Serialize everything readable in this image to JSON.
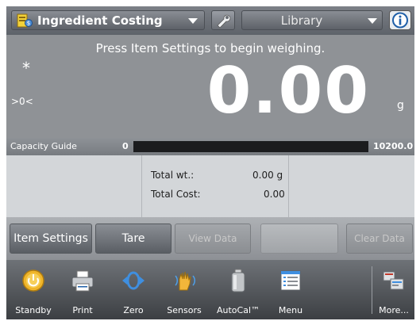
{
  "header": {
    "app_title": "Ingredient Costing",
    "library_label": "Library",
    "app_icon": "ingredient-costing-icon",
    "settings_icon": "wrench-icon",
    "info_icon": "info-icon"
  },
  "display": {
    "prompt": "Press Item Settings to begin weighing.",
    "stable_indicator": "*",
    "center_zero_indicator": ">0<",
    "weight_value": "0.00",
    "unit": "g"
  },
  "capacity_guide": {
    "label": "Capacity Guide",
    "min": "0",
    "max": "10200.0",
    "fill_fraction": 0.0
  },
  "data_panel": {
    "total_wt_label": "Total wt.:",
    "total_wt_value": "0.00 g",
    "total_cost_label": "Total Cost:",
    "total_cost_value": "0.00"
  },
  "softkeys": {
    "item_settings": "Item Settings",
    "tare": "Tare",
    "view_data": "View Data",
    "clear_data": "Clear Data"
  },
  "nav": {
    "items": [
      {
        "label": "Standby",
        "icon": "standby-icon"
      },
      {
        "label": "Print",
        "icon": "printer-icon"
      },
      {
        "label": "Zero",
        "icon": "zero-icon"
      },
      {
        "label": "Sensors",
        "icon": "hand-sensor-icon"
      },
      {
        "label": "AutoCal™",
        "icon": "calibration-weight-icon"
      },
      {
        "label": "Menu",
        "icon": "menu-icon"
      },
      {
        "label": "More...",
        "icon": "more-icon"
      }
    ]
  },
  "colors": {
    "display_bg": "#8f9296",
    "capacity_fill": "#6fae3d",
    "standby_icon": "#f0b52a"
  }
}
